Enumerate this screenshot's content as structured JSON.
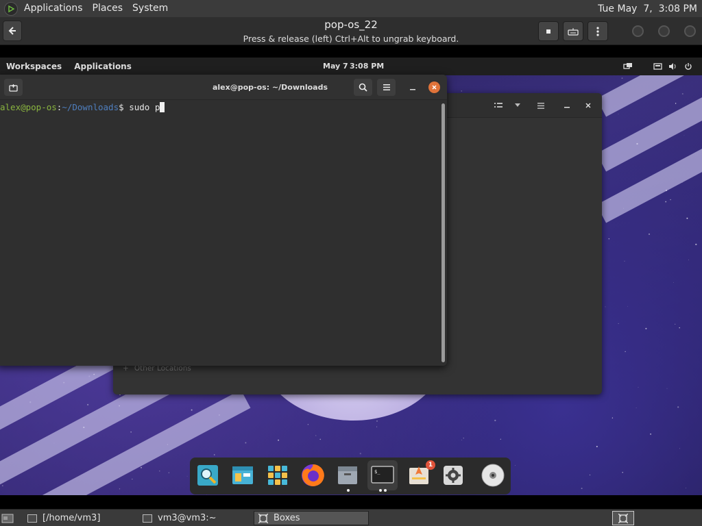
{
  "host_panel": {
    "menus": [
      "Applications",
      "Places",
      "System"
    ],
    "clock": "Tue May  7,  3:08 PM"
  },
  "boxes_header": {
    "title": "pop-os_22",
    "subtitle": "Press & release (left) Ctrl+Alt to ungrab keyboard."
  },
  "guest_panel": {
    "workspaces": "Workspaces",
    "applications": "Applications",
    "date": "May 7",
    "time": "3:08 PM"
  },
  "terminal": {
    "title": "alex@pop-os: ~/Downloads",
    "prompt_user": "alex@pop-os",
    "prompt_sep": ":",
    "prompt_path": "~/Downloads",
    "prompt_symbol": "$ ",
    "command": "sudo p"
  },
  "files_window": {
    "sidebar_other_locations": "Other Locations"
  },
  "dock": {
    "items": [
      "search-icon",
      "files-manager-icon",
      "app-grid-icon",
      "firefox-icon",
      "files-icon",
      "terminal-icon",
      "launcher-icon",
      "settings-icon",
      "disc-icon"
    ],
    "launcher_badge": "1",
    "terminal_prompt_glyph": "$_"
  },
  "taskbar": {
    "items": [
      "[/home/vm3]",
      "vm3@vm3:~",
      "Boxes"
    ]
  },
  "colors": {
    "prompt_user": "#8ab53f",
    "prompt_path": "#4f7fbf",
    "close_button": "#e0733a"
  }
}
